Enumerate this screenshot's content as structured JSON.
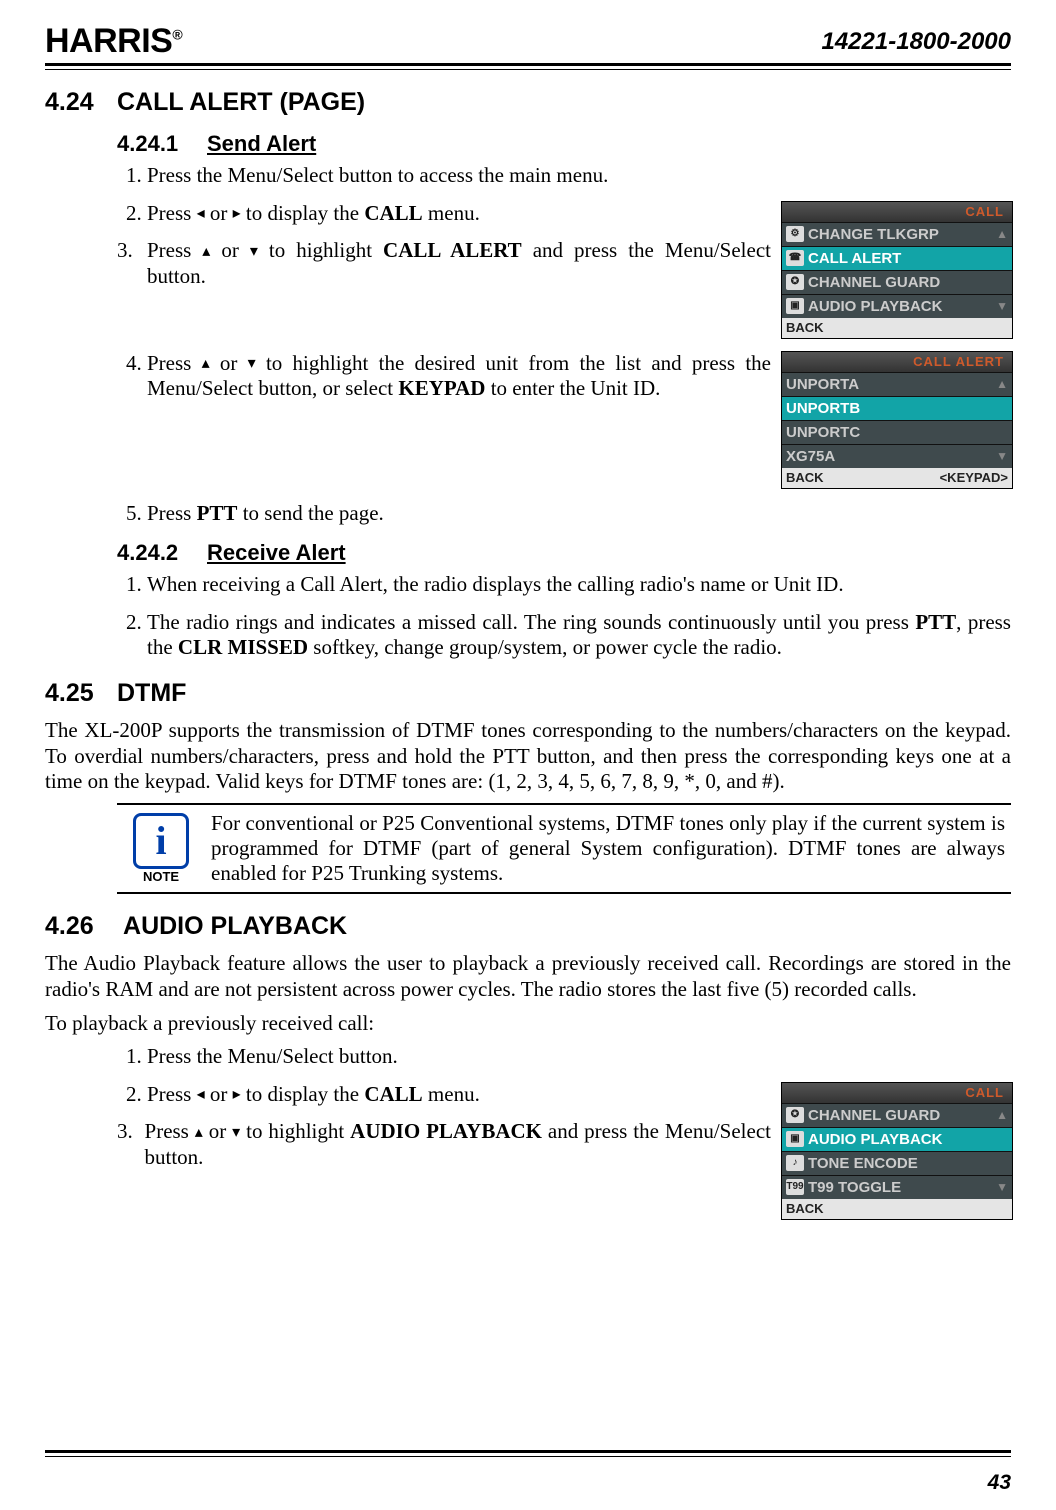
{
  "header": {
    "logo": "HARRIS",
    "logo_reg": "®",
    "docnum": "14221-1800-2000"
  },
  "arrows": {
    "left": "◂",
    "right": "▸",
    "up": "▴",
    "down": "▾"
  },
  "s424": {
    "num": "4.24",
    "title": "CALL ALERT (PAGE)",
    "sub1": {
      "num": "4.24.1",
      "title": "Send Alert",
      "steps": {
        "1": "Press the Menu/Select button to access the main menu.",
        "2a": "Press ",
        "2b": " or ",
        "2c": " to display the ",
        "2d": "CALL",
        "2e": " menu.",
        "3a": "Press ",
        "3b": " or ",
        "3c": " to highlight ",
        "3d": "CALL ALERT",
        "3e": " and press the Menu/Select button.",
        "4a": "Press ",
        "4b": " or ",
        "4c": " to highlight the desired unit from the list and press the Menu/Select button, or select ",
        "4d": "KEYPAD",
        "4e": " to enter the Unit ID.",
        "5a": "Press ",
        "5b": "PTT",
        "5c": " to send the page."
      }
    },
    "sub2": {
      "num": "4.24.2",
      "title": "Receive Alert",
      "steps": {
        "1": "When receiving a Call Alert, the radio displays the calling radio's name or Unit ID.",
        "2a": "The radio rings and indicates a missed call. The ring sounds continuously until you press ",
        "2b": "PTT",
        "2c": ", press the ",
        "2d": "CLR MISSED",
        "2e": " softkey, change group/system, or power cycle the radio."
      }
    }
  },
  "s425": {
    "num": "4.25",
    "title": "DTMF",
    "body": "The XL-200P supports the transmission of DTMF tones corresponding to the numbers/characters on the keypad.  To overdial numbers/characters, press and hold the PTT button, and then press the corresponding keys one at a time on the keypad. Valid keys for DTMF tones are: (1, 2, 3, 4, 5, 6, 7, 8, 9, *, 0, and #).",
    "note_label": "NOTE",
    "note": "For conventional or P25 Conventional systems, DTMF tones only play if the current system is programmed for DTMF (part of general System configuration). DTMF tones are always enabled for P25 Trunking systems."
  },
  "s426": {
    "num": "4.26",
    "title": " AUDIO PLAYBACK",
    "body": "The Audio Playback feature allows the user to playback a previously received call. Recordings are stored in the radio's RAM and are not persistent across power cycles.  The radio stores the last five (5) recorded calls.",
    "body2": "To playback a previously received call:",
    "steps": {
      "1": "Press the Menu/Select button.",
      "2a": "Press ",
      "2b": " or ",
      "2c": " to display the ",
      "2d": "CALL",
      "2e": " menu.",
      "3a": "Press ",
      "3b": " or ",
      "3c": " to highlight ",
      "3d": "AUDIO PLAYBACK",
      "3e": " and press the Menu/Select button."
    }
  },
  "screens": {
    "call_menu": {
      "tab": "CALL",
      "items": [
        "CHANGE TLKGRP",
        "CALL ALERT",
        "CHANNEL GUARD",
        "AUDIO PLAYBACK"
      ],
      "sel": 1,
      "back": "BACK",
      "right": ""
    },
    "call_alert": {
      "tab": "CALL ALERT",
      "items": [
        "UNPORTA",
        "UNPORTB",
        "UNPORTC",
        "XG75A"
      ],
      "sel": 1,
      "back": "BACK",
      "right": "<KEYPAD>"
    },
    "audio_menu": {
      "tab": "CALL",
      "items": [
        "CHANNEL GUARD",
        "AUDIO PLAYBACK",
        "TONE ENCODE",
        "T99 TOGGLE"
      ],
      "sel": 1,
      "back": "BACK",
      "right": ""
    }
  },
  "page_number": "43"
}
